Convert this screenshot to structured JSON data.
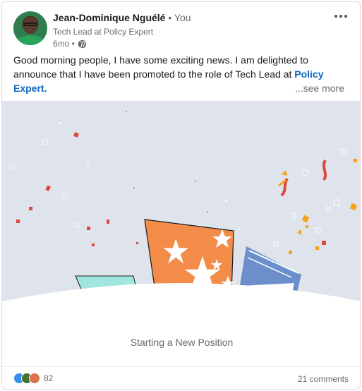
{
  "author": {
    "name": "Jean-Dominique Nguélé",
    "relation": "• You",
    "headline": "Tech Lead at Policy Expert",
    "time": "6mo •",
    "visibility_icon": "globe-icon"
  },
  "post": {
    "text_part1": "Good morning people, I have some exciting news. I am delighted to announce that I have been promoted to the role of Tech Lead at ",
    "link_text": "Policy Expert",
    "text_part2": ".",
    "see_more": "...see more"
  },
  "media": {
    "caption": "Starting a New Position"
  },
  "social": {
    "reaction_icons": [
      "like-icon",
      "celebrate-icon",
      "love-icon"
    ],
    "reaction_count": "82",
    "comments": "21 comments"
  },
  "colors": {
    "link": "#0a66c2",
    "orange_box": "#f28c48",
    "blue_box": "#6c8fcb",
    "teal_box": "#a2e5df",
    "confetti_red": "#e0473d",
    "confetti_orange": "#f4a31c",
    "background": "#dfe3eb"
  }
}
